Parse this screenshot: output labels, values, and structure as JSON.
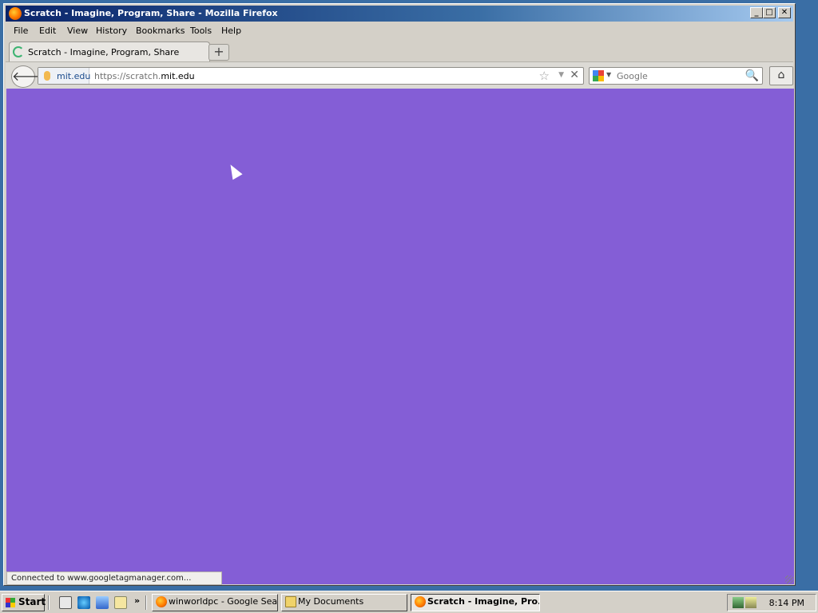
{
  "window": {
    "title": "Scratch - Imagine, Program, Share - Mozilla Firefox",
    "controls": {
      "minimize": "_",
      "maximize": "□",
      "close": "✕"
    }
  },
  "menubar": {
    "items": [
      {
        "label": "File",
        "access_key": "F"
      },
      {
        "label": "Edit",
        "access_key": "E"
      },
      {
        "label": "View",
        "access_key": "V"
      },
      {
        "label": "History",
        "access_key": "H"
      },
      {
        "label": "Bookmarks",
        "access_key": "B"
      },
      {
        "label": "Tools",
        "access_key": "T"
      },
      {
        "label": "Help",
        "access_key": "H"
      }
    ]
  },
  "tabs": {
    "active": {
      "label": "Scratch - Imagine, Program, Share",
      "icon": "loading-spinner-icon"
    },
    "new_tab_label": "+"
  },
  "navbar": {
    "back_glyph": "🡐",
    "identity_label": "mit.edu",
    "url_prefix": "https://scratch.",
    "url_host": "mit.edu",
    "star_glyph": "☆",
    "dropdown_glyph": "▼",
    "stop_glyph": "✕",
    "search_placeholder": "Google",
    "search_drop_glyph": "▼",
    "search_glyph": "🔍",
    "home_glyph": "⌂"
  },
  "content": {
    "background_color": "#845ed6"
  },
  "statusbar": {
    "text": "Connected to www.googletagmanager.com..."
  },
  "taskbar": {
    "start_label": "Start",
    "quicklaunch_more": "»",
    "tasks": [
      {
        "label": "winworldpc - Google Sear...",
        "icon": "firefox-icon",
        "active": false
      },
      {
        "label": "My Documents",
        "icon": "folder-icon",
        "active": false
      },
      {
        "label": "Scratch - Imagine, Pro...",
        "icon": "firefox-icon",
        "active": true
      }
    ],
    "clock": "8:14 PM"
  },
  "colors": {
    "title_gradient_start": "#0a246a",
    "title_gradient_end": "#a6caf0",
    "chrome": "#d4d0c8",
    "content_purple": "#845ed6",
    "desktop": "#3a6ea5"
  }
}
